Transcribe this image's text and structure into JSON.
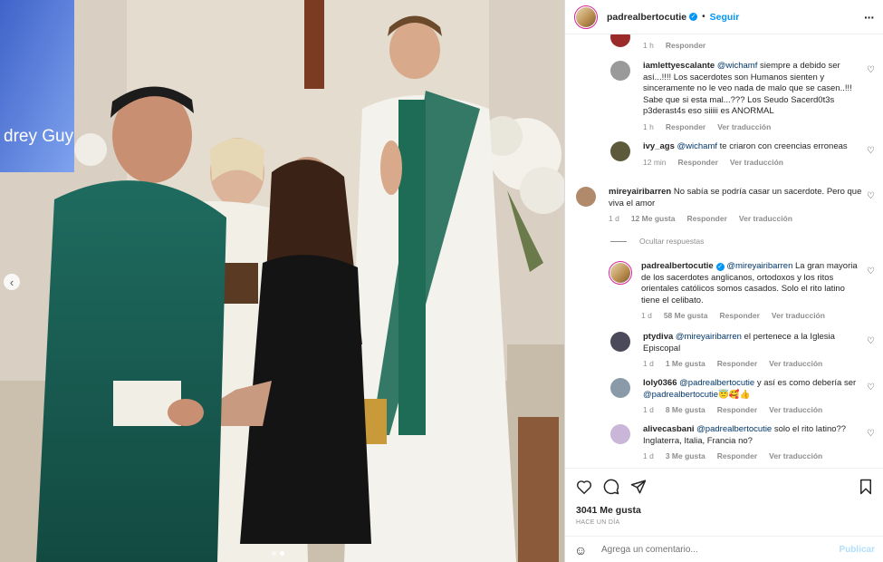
{
  "photo": {
    "screen_text": "drey Guy",
    "carousel_prev_icon": "chevron-left-icon"
  },
  "header": {
    "username": "padrealbertocutie",
    "separator": "•",
    "follow_label": "Seguir",
    "more_icon": "more-horizontal-icon"
  },
  "comments": [
    {
      "username": "",
      "text": "",
      "time": "1 h",
      "reply": "Responder",
      "likes": "",
      "translate": "",
      "color": "#9b2b2b"
    },
    {
      "username": "iamlettyescalante",
      "mention": "@wichamf",
      "text": " siempre a debido ser así...!!!! Los sacerdotes son Humanos sienten y sinceramente no le veo nada de malo que se casen..!!! Sabe que si esta mal...??? Los Seudo Sacerd0t3s p3derast4s eso siiiii es ANORMAL",
      "time": "1 h",
      "reply": "Responder",
      "likes": "",
      "translate": "Ver traducción",
      "color": "#9a9a9a"
    },
    {
      "username": "ivy_ags",
      "mention": "@wichamf",
      "text": " te criaron con creencias erroneas",
      "time": "12 min",
      "reply": "Responder",
      "likes": "",
      "translate": "Ver traducción",
      "color": "#5c5a3a"
    },
    {
      "username": "mireyairibarren",
      "mention": "",
      "text": " No sabía se podría casar un sacerdote. Pero que viva el amor",
      "time": "1 d",
      "reply": "Responder",
      "likes": "12 Me gusta",
      "translate": "Ver traducción",
      "color": "#b08a6a"
    },
    {
      "username": "padrealbertocutie",
      "mention": "@mireyairibarren",
      "text": " La gran mayoria de los sacerdotes anglicanos, ortodoxos y los ritos orientales católicos somos casados. Solo el rito latino tiene el celibato.",
      "time": "1 d",
      "reply": "Responder",
      "likes": "58 Me gusta",
      "translate": "Ver traducción",
      "color": "#c9a46a"
    },
    {
      "username": "ptydiva",
      "mention": "@mireyairibarren",
      "text": " el pertenece a la Iglesia Episcopal",
      "time": "1 d",
      "reply": "Responder",
      "likes": "1 Me gusta",
      "translate": "Ver traducción",
      "color": "#4a4a5a"
    },
    {
      "username": "loly0366",
      "mention": "@padrealbertocutie",
      "text": " y así es como debería ser ",
      "mention2": "@padrealbertocutie",
      "emojis": "😇🥰👍",
      "time": "1 d",
      "reply": "Responder",
      "likes": "8 Me gusta",
      "translate": "Ver traducción",
      "color": "#8a9aa8"
    },
    {
      "username": "alivecasbani",
      "mention": "@padrealbertocutie",
      "text": " solo el rito latino?? Inglaterra, Italia, Francia no?",
      "time": "1 d",
      "reply": "Responder",
      "likes": "3 Me gusta",
      "translate": "Ver traducción",
      "color": "#c9b6d8"
    }
  ],
  "hide_replies": "Ocultar respuestas",
  "footer": {
    "likes": "3041 Me gusta",
    "time": "Hace un día",
    "comment_placeholder": "Agrega un comentario...",
    "publish_label": "Publicar"
  },
  "colors": {
    "accent": "#0095f6",
    "mention": "#00376b",
    "muted": "#8e8e8e"
  }
}
